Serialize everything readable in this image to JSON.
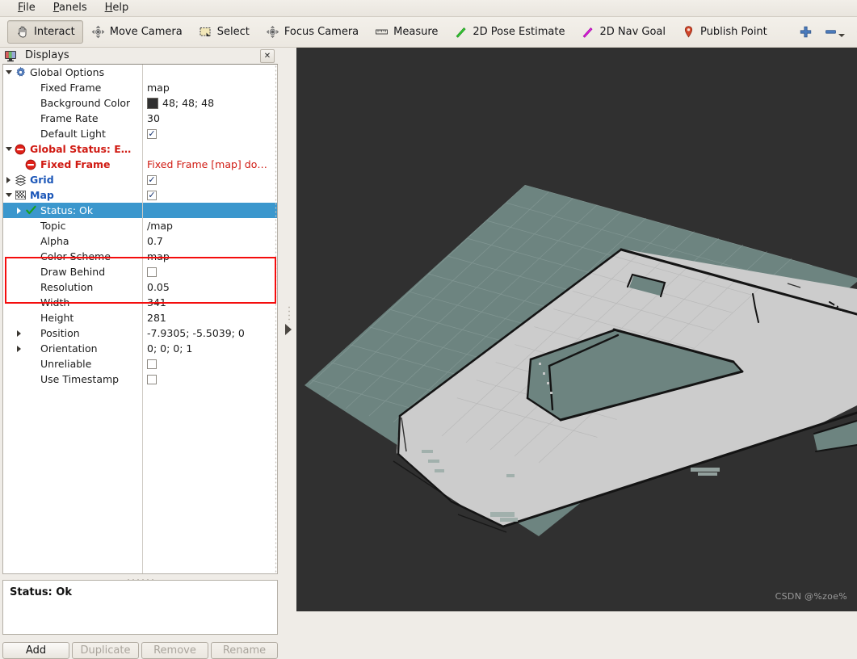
{
  "menu": {
    "items": [
      {
        "label": "File",
        "mnemonic": "F"
      },
      {
        "label": "Panels",
        "mnemonic": "P"
      },
      {
        "label": "Help",
        "mnemonic": "H"
      }
    ]
  },
  "toolbar": {
    "tools": [
      {
        "label": "Interact",
        "icon": "hand-cursor-icon",
        "active": true
      },
      {
        "label": "Move Camera",
        "icon": "move-camera-icon",
        "active": false
      },
      {
        "label": "Select",
        "icon": "select-rectangle-icon",
        "active": false
      },
      {
        "label": "Focus Camera",
        "icon": "focus-camera-icon",
        "active": false
      },
      {
        "label": "Measure",
        "icon": "ruler-icon",
        "active": false
      },
      {
        "label": "2D Pose Estimate",
        "icon": "green-arrow-icon",
        "active": false
      },
      {
        "label": "2D Nav Goal",
        "icon": "magenta-arrow-icon",
        "active": false
      },
      {
        "label": "Publish Point",
        "icon": "map-pin-icon",
        "active": false
      }
    ],
    "add_tool_icon": "plus-icon",
    "remove_tool_icon": "minus-icon",
    "visibility_icon": "eye-icon"
  },
  "displays_panel": {
    "title": "Displays",
    "title_icon": "monitor-icon",
    "close_label": "✕",
    "rows": [
      {
        "indent": 0,
        "arrow": "down",
        "icon": "gear-icon",
        "label": "Global Options",
        "style": "plain",
        "value": "",
        "value_type": "none"
      },
      {
        "indent": 1,
        "arrow": "none",
        "icon": "none",
        "label": "Fixed Frame",
        "style": "plain",
        "value": "map",
        "value_type": "text"
      },
      {
        "indent": 1,
        "arrow": "none",
        "icon": "none",
        "label": "Background Color",
        "style": "plain",
        "value": "48; 48; 48",
        "value_type": "color",
        "color": "#303030"
      },
      {
        "indent": 1,
        "arrow": "none",
        "icon": "none",
        "label": "Frame Rate",
        "style": "plain",
        "value": "30",
        "value_type": "text"
      },
      {
        "indent": 1,
        "arrow": "none",
        "icon": "none",
        "label": "Default Light",
        "style": "plain",
        "value": "checked",
        "value_type": "checkbox"
      },
      {
        "indent": 0,
        "arrow": "down",
        "icon": "error-icon",
        "label": "Global Status: E…",
        "style": "red",
        "value": "",
        "value_type": "none"
      },
      {
        "indent": 1,
        "arrow": "none",
        "icon": "error-icon",
        "label": "Fixed Frame",
        "style": "red",
        "value": "Fixed Frame [map] do…",
        "value_type": "text"
      },
      {
        "indent": 0,
        "arrow": "right",
        "icon": "grid-icon",
        "label": "Grid",
        "style": "blue",
        "value": "checked",
        "value_type": "checkbox"
      },
      {
        "indent": 0,
        "arrow": "down",
        "icon": "map-icon",
        "label": "Map",
        "style": "blue",
        "value": "checked",
        "value_type": "checkbox"
      },
      {
        "indent": 1,
        "arrow": "right",
        "icon": "check-ok-icon",
        "label": "Status: Ok",
        "style": "selected",
        "value": "",
        "value_type": "none"
      },
      {
        "indent": 1,
        "arrow": "none",
        "icon": "none",
        "label": "Topic",
        "style": "plain",
        "value": "/map",
        "value_type": "text"
      },
      {
        "indent": 1,
        "arrow": "none",
        "icon": "none",
        "label": "Alpha",
        "style": "plain",
        "value": "0.7",
        "value_type": "text"
      },
      {
        "indent": 1,
        "arrow": "none",
        "icon": "none",
        "label": "Color Scheme",
        "style": "plain",
        "value": "map",
        "value_type": "text"
      },
      {
        "indent": 1,
        "arrow": "none",
        "icon": "none",
        "label": "Draw Behind",
        "style": "plain",
        "value": "unchecked",
        "value_type": "checkbox"
      },
      {
        "indent": 1,
        "arrow": "none",
        "icon": "none",
        "label": "Resolution",
        "style": "plain",
        "value": "0.05",
        "value_type": "text"
      },
      {
        "indent": 1,
        "arrow": "none",
        "icon": "none",
        "label": "Width",
        "style": "plain",
        "value": "341",
        "value_type": "text"
      },
      {
        "indent": 1,
        "arrow": "none",
        "icon": "none",
        "label": "Height",
        "style": "plain",
        "value": "281",
        "value_type": "text"
      },
      {
        "indent": 1,
        "arrow": "right",
        "icon": "none",
        "label": "Position",
        "style": "plain",
        "value": "-7.9305; -5.5039; 0",
        "value_type": "text"
      },
      {
        "indent": 1,
        "arrow": "right",
        "icon": "none",
        "label": "Orientation",
        "style": "plain",
        "value": "0; 0; 0; 1",
        "value_type": "text"
      },
      {
        "indent": 1,
        "arrow": "none",
        "icon": "none",
        "label": "Unreliable",
        "style": "plain",
        "value": "unchecked",
        "value_type": "checkbox"
      },
      {
        "indent": 1,
        "arrow": "none",
        "icon": "none",
        "label": "Use Timestamp",
        "style": "plain",
        "value": "unchecked",
        "value_type": "checkbox"
      }
    ],
    "highlight_color": "#f40d0d",
    "selection_color": "#3b97cd",
    "status_text": "Status: Ok",
    "buttons": [
      {
        "label": "Add",
        "enabled": true
      },
      {
        "label": "Duplicate",
        "enabled": false
      },
      {
        "label": "Remove",
        "enabled": false
      },
      {
        "label": "Rename",
        "enabled": false
      }
    ]
  },
  "view3d": {
    "background_color": "#303030",
    "ground_plane_color": "#6d8480",
    "map_free_color": "#cccccc",
    "map_occupied_color": "#1a1a1a",
    "grid_line_color": "#9aa8a5",
    "watermark": "CSDN @%zoe%"
  }
}
